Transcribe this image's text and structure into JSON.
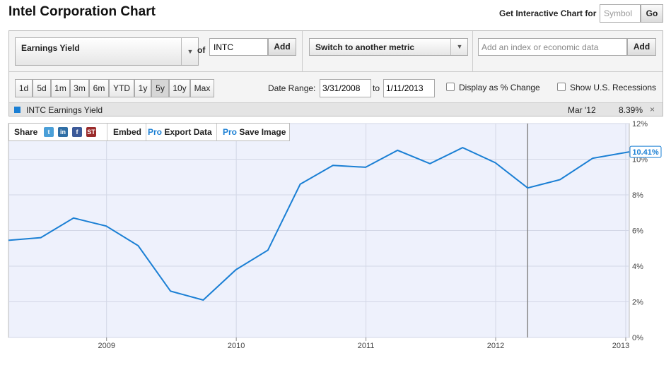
{
  "page": {
    "title": "Intel Corporation Chart"
  },
  "interactive": {
    "label": "Get Interactive Chart for",
    "symbol_placeholder": "Symbol",
    "go_label": "Go"
  },
  "metric": {
    "selected": "Earnings Yield",
    "of_label": "of",
    "ticker": "INTC",
    "add_label": "Add"
  },
  "switch": {
    "label": "Switch to another metric"
  },
  "index": {
    "placeholder": "Add an index or economic data",
    "add_label": "Add"
  },
  "ranges": [
    "1d",
    "5d",
    "1m",
    "3m",
    "6m",
    "YTD",
    "1y",
    "5y",
    "10y",
    "Max"
  ],
  "active_range": "5y",
  "date_range": {
    "label": "Date Range:",
    "from": "3/31/2008",
    "to_label": "to",
    "to": "1/11/2013"
  },
  "options": {
    "percent_change": "Display as % Change",
    "recessions": "Show U.S. Recessions"
  },
  "legend": {
    "name": "INTC Earnings Yield",
    "date": "Mar '12",
    "value": "8.39%",
    "close": "×",
    "color": "#1a7fd4"
  },
  "share_bar": {
    "share": "Share",
    "embed": "Embed",
    "pro": "Pro",
    "export": "Export Data",
    "save": "Save Image"
  },
  "social_icons": [
    {
      "name": "twitter-icon",
      "glyph": "t",
      "color": "#4a9fd8"
    },
    {
      "name": "linkedin-icon",
      "glyph": "in",
      "color": "#2f6ea5"
    },
    {
      "name": "facebook-icon",
      "glyph": "f",
      "color": "#3b5998"
    },
    {
      "name": "stocktwits-icon",
      "glyph": "ST",
      "color": "#9a2b2b"
    }
  ],
  "chart_data": {
    "type": "line",
    "series": [
      {
        "name": "INTC Earnings Yield",
        "color": "#1a7fd4",
        "x": [
          "2008-03-31",
          "2008-06-30",
          "2008-09-30",
          "2008-12-31",
          "2009-03-31",
          "2009-06-30",
          "2009-09-30",
          "2009-12-31",
          "2010-03-31",
          "2010-06-30",
          "2010-09-30",
          "2010-12-31",
          "2011-03-31",
          "2011-06-30",
          "2011-09-30",
          "2011-12-31",
          "2012-03-31",
          "2012-06-30",
          "2012-09-30",
          "2013-01-11"
        ],
        "y": [
          5.45,
          5.6,
          6.7,
          6.25,
          5.15,
          2.6,
          2.1,
          3.8,
          4.9,
          8.6,
          9.65,
          9.55,
          10.5,
          9.75,
          10.65,
          9.8,
          8.39,
          8.85,
          10.05,
          10.41
        ]
      }
    ],
    "x_ticks": [
      "2009",
      "2010",
      "2011",
      "2012",
      "2013"
    ],
    "y_ticks": [
      "0%",
      "2%",
      "4%",
      "6%",
      "8%",
      "10%",
      "12%"
    ],
    "ylim": [
      0,
      12
    ],
    "xlim": [
      "2008-03-31",
      "2013-01-11"
    ],
    "last_value_label": "10.41%",
    "marker_date": "2012-03-31",
    "grid": true
  }
}
